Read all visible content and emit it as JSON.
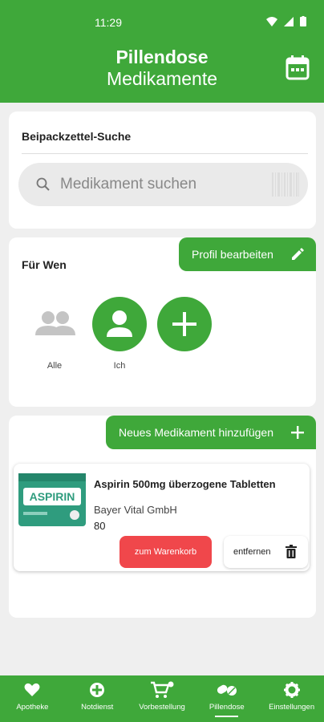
{
  "status": {
    "time": "11:29"
  },
  "header": {
    "title": "Pillendose",
    "subtitle": "Medikamente"
  },
  "search_section": {
    "title": "Beipackzettel-Suche",
    "placeholder": "Medikament suchen"
  },
  "for_whom": {
    "title": "Für Wen",
    "edit_label": "Profil bearbeiten",
    "profiles": [
      {
        "label": "Alle"
      },
      {
        "label": "Ich"
      },
      {
        "label": ""
      }
    ]
  },
  "medications": {
    "add_label": "Neues Medikament hinzufügen",
    "items": [
      {
        "name": "Aspirin 500mg überzogene Tabletten",
        "manufacturer": "Bayer Vital GmbH",
        "quantity": "80",
        "cart_label": "zum Warenkorb",
        "remove_label": "entfernen",
        "image_brand": "ASPIRIN"
      }
    ]
  },
  "bottom_nav": [
    {
      "label": "Apotheke",
      "icon": "heart-icon"
    },
    {
      "label": "Notdienst",
      "icon": "emergency-icon"
    },
    {
      "label": "Vorbestellung",
      "icon": "cart-icon"
    },
    {
      "label": "Pillendose",
      "icon": "pills-icon",
      "active": true
    },
    {
      "label": "Einstellungen",
      "icon": "gear-icon"
    }
  ],
  "colors": {
    "primary": "#3fa83a",
    "danger": "#f0474b",
    "background": "#efefef"
  }
}
